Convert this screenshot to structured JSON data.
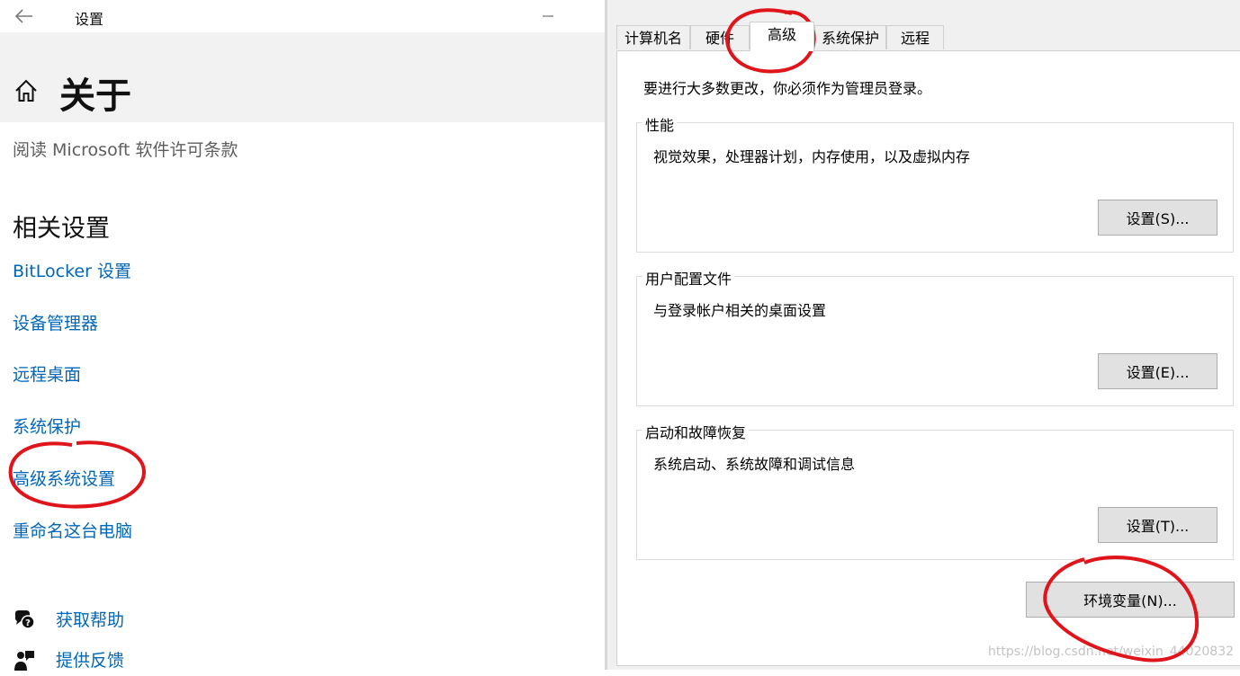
{
  "settings": {
    "app_title": "设置",
    "page_title": "关于",
    "license_link": "阅读 Microsoft 软件许可条款",
    "related_title": "相关设置",
    "links": [
      {
        "label": "BitLocker 设置"
      },
      {
        "label": "设备管理器"
      },
      {
        "label": "远程桌面"
      },
      {
        "label": "系统保护"
      },
      {
        "label": "高级系统设置"
      },
      {
        "label": "重命名这台电脑"
      }
    ],
    "help": [
      {
        "label": "获取帮助",
        "icon": "help-chat-icon"
      },
      {
        "label": "提供反馈",
        "icon": "feedback-icon"
      }
    ],
    "icons": {
      "back": "back-arrow-icon",
      "home": "home-icon",
      "minimize": "minimize-icon"
    }
  },
  "dialog": {
    "tabs": [
      {
        "label": "计算机名"
      },
      {
        "label": "硬件"
      },
      {
        "label": "高级",
        "active": true
      },
      {
        "label": "系统保护"
      },
      {
        "label": "远程"
      }
    ],
    "admin_note": "要进行大多数更改，你必须作为管理员登录。",
    "groups": [
      {
        "title": "性能",
        "desc": "视觉效果，处理器计划，内存使用，以及虚拟内存",
        "button": "设置(S)..."
      },
      {
        "title": "用户配置文件",
        "desc": "与登录帐户相关的桌面设置",
        "button": "设置(E)..."
      },
      {
        "title": "启动和故障恢复",
        "desc": "系统启动、系统故障和调试信息",
        "button": "设置(T)..."
      }
    ],
    "env_button": "环境变量(N)..."
  },
  "watermark": "https://blog.csdn.net/weixin_44020832",
  "colors": {
    "link": "#0067b8",
    "annotation": "#e0151b",
    "header_band": "#f2f2f2",
    "dialog_bg": "#f0f0f0"
  }
}
